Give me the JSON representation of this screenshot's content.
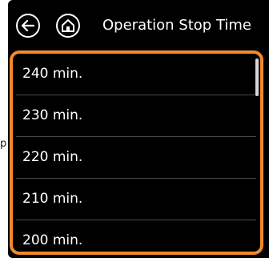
{
  "side_fragment": "p",
  "header": {
    "back_icon": "back-arrow-icon",
    "home_icon": "home-icon",
    "title": "Operation Stop Time"
  },
  "list": {
    "items": [
      {
        "label": "240 min."
      },
      {
        "label": "230 min."
      },
      {
        "label": "220 min."
      },
      {
        "label": "210 min."
      },
      {
        "label": "200 min."
      }
    ],
    "scroll_position": 0
  },
  "colors": {
    "background": "#000000",
    "accent_border": "#f28a2c",
    "text": "#ffffff",
    "divider": "#4a4a4a",
    "scrollbar": "#d8d8d8"
  }
}
